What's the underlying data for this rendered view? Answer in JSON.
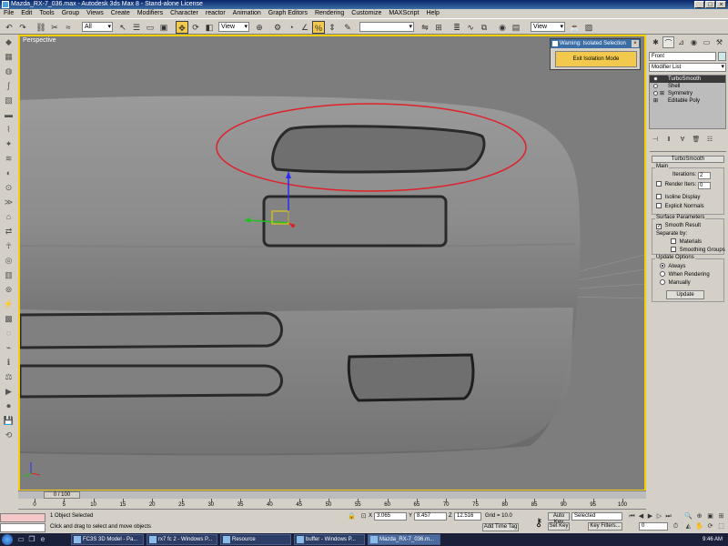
{
  "window": {
    "title": "Mazda_RX-7_036.max - Autodesk 3ds Max 8 - Stand-alone License"
  },
  "menu": [
    "File",
    "Edit",
    "Tools",
    "Group",
    "Views",
    "Create",
    "Modifiers",
    "Character",
    "reactor",
    "Animation",
    "Graph Editors",
    "Rendering",
    "Customize",
    "MAXScript",
    "Help"
  ],
  "toolbar": {
    "selection_filter": "All",
    "reference_coord": "View",
    "named_selection": "",
    "viewport_dropdown": "View"
  },
  "viewport": {
    "label": "Perspective",
    "border_color": "#f5d000",
    "highlight_color": "#e0202a"
  },
  "isolation": {
    "title": "Warning: Isolated Selection",
    "exit_label": "Exit Isolation Mode"
  },
  "command_panel": {
    "object_name": "Front",
    "modifier_list": "Modifier List",
    "stack": [
      {
        "label": "TurboSmooth",
        "selected": true
      },
      {
        "label": "Shell",
        "selected": false
      },
      {
        "label": "Symmetry",
        "selected": false
      },
      {
        "label": "Editable Poly",
        "selected": false
      }
    ],
    "rollout_title": "TurboSmooth",
    "main_group": "Main",
    "iterations_label": "Iterations:",
    "iterations_value": "2",
    "render_iters_label": "Render Iters:",
    "render_iters_value": "0",
    "isoline_label": "Isoline Display",
    "explicit_normals_label": "Explicit Normals",
    "surface_group": "Surface Parameters",
    "smooth_result_label": "Smooth Result",
    "separate_by_label": "Separate by:",
    "materials_label": "Materials",
    "smoothing_groups_label": "Smoothing Groups",
    "update_group": "Update Options",
    "always_label": "Always",
    "when_rendering_label": "When Rendering",
    "manually_label": "Manually",
    "update_button": "Update"
  },
  "timeline": {
    "frame_display": "0 / 100",
    "ticks": [
      "0",
      "5",
      "10",
      "15",
      "20",
      "25",
      "30",
      "35",
      "40",
      "45",
      "50",
      "55",
      "60",
      "65",
      "70",
      "75",
      "80",
      "85",
      "90",
      "95",
      "100"
    ]
  },
  "status": {
    "selection_text": "1 Object Selected",
    "prompt_text": "Click and drag to select and move objects",
    "x_label": "X",
    "x_value": "3.065",
    "y_label": "Y",
    "y_value": "8.457",
    "z_label": "Z",
    "z_value": "12.516",
    "grid_text": "Grid = 10.0",
    "add_time_tag": "Add Time Tag",
    "auto_key": "Auto Key",
    "selected_dropdown": "Selected",
    "set_key": "Set Key",
    "key_filters": "Key Filters...",
    "frame_value": "0"
  },
  "taskbar": {
    "tasks": [
      {
        "label": "FC3S 3D Model - Pa...",
        "active": false
      },
      {
        "label": "rx7 fc 2 - Windows P...",
        "active": false
      },
      {
        "label": "Resource",
        "active": false
      },
      {
        "label": "buffer - Windows P...",
        "active": false
      },
      {
        "label": "Mazda_RX-7_036.m...",
        "active": true
      }
    ],
    "clock": "9:46 AM"
  }
}
